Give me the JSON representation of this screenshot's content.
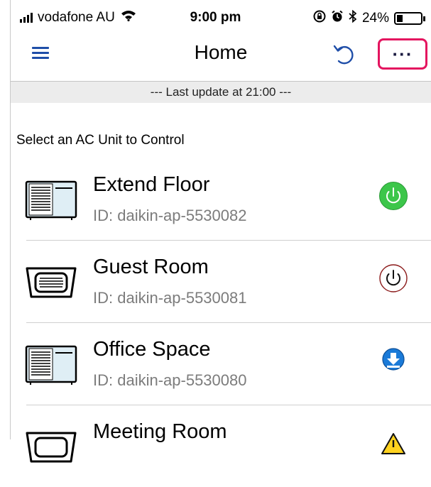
{
  "status_bar": {
    "carrier": "vodafone AU",
    "time": "9:00 pm",
    "battery_percent": "24%",
    "battery_level": 0.24
  },
  "nav": {
    "title": "Home",
    "more_label": "···"
  },
  "banner": {
    "text": "--- Last update at 21:00 ---"
  },
  "section_label": "Select an  AC Unit to Control",
  "ac_units": [
    {
      "name": "Extend Floor",
      "id": "ID: daikin-ap-5530082",
      "unit_type": "floor-unit-icon",
      "status": "power-on"
    },
    {
      "name": "Guest Room",
      "id": "ID: daikin-ap-5530081",
      "unit_type": "ceiling-cassette-icon",
      "status": "power-off"
    },
    {
      "name": "Office Space",
      "id": "ID: daikin-ap-5530080",
      "unit_type": "floor-unit-icon",
      "status": "download"
    },
    {
      "name": "Meeting Room",
      "id": "",
      "unit_type": "ceiling-cassette-icon",
      "status": "warning"
    }
  ],
  "colors": {
    "accent_blue": "#1f4ea8",
    "highlight_pink": "#e4145f",
    "power_on_green": "#3cc64a",
    "power_off_red": "#8b1a1a",
    "download_blue": "#1a7ad8"
  }
}
